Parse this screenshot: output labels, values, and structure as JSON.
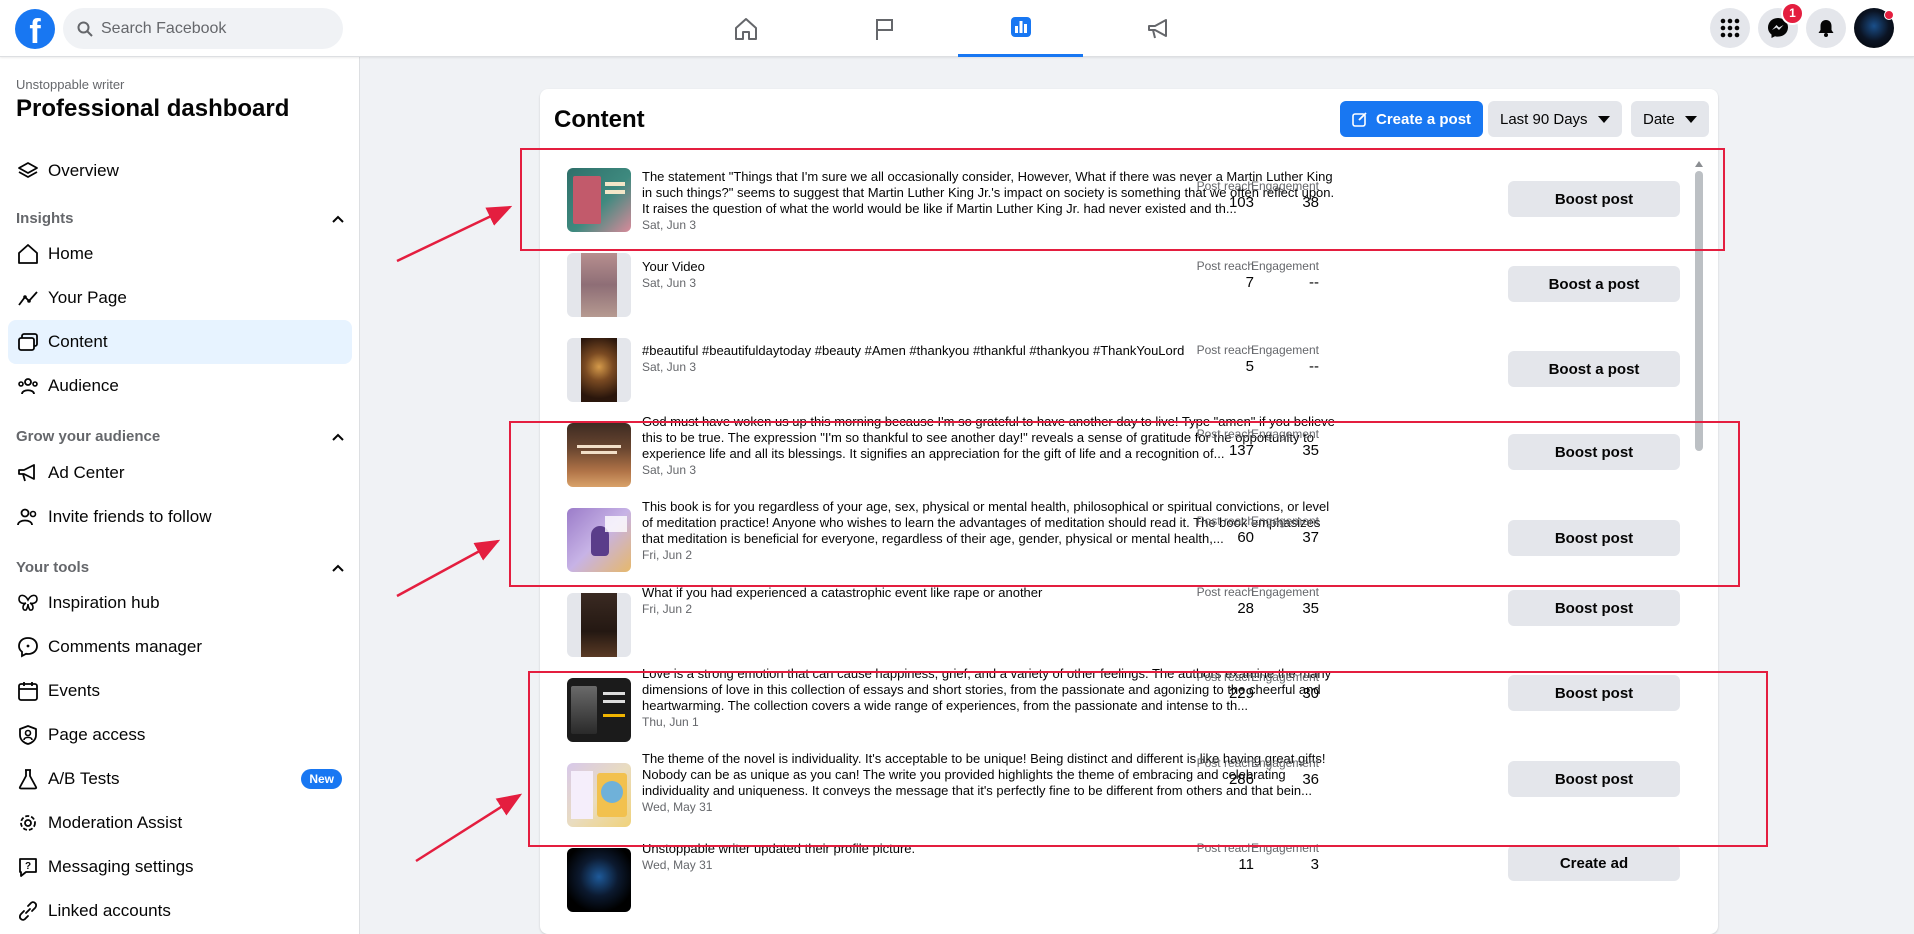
{
  "topbar": {
    "search_placeholder": "Search Facebook",
    "notification_count": "1",
    "nav_tabs": [
      "home-tab",
      "pages-tab",
      "professional-dashboard-tab",
      "ad-center-tab"
    ]
  },
  "sidebar": {
    "page_name": "Unstoppable writer",
    "title": "Professional dashboard",
    "overview": "Overview",
    "sections": {
      "insights": "Insights",
      "grow": "Grow your audience",
      "tools": "Your tools"
    },
    "insights_items": [
      "Home",
      "Your Page",
      "Content",
      "Audience"
    ],
    "grow_items": [
      "Ad Center",
      "Invite friends to follow"
    ],
    "tools_items": [
      "Inspiration hub",
      "Comments manager",
      "Events",
      "Page access",
      "A/B Tests",
      "Moderation Assist",
      "Messaging settings",
      "Linked accounts"
    ],
    "new_badge": "New"
  },
  "content": {
    "title": "Content",
    "create_post": "Create a post",
    "range_filter": "Last 90 Days",
    "sort_filter": "Date",
    "reach_label": "Post reach",
    "engagement_label": "Engagement",
    "posts": [
      {
        "text": "The statement \"Things that I'm sure we all occasionally consider, However, What if there was never a Martin Luther King in such things?\" seems to suggest that Martin Luther King Jr.'s impact on society is something that we often reflect upon. It raises the question of what the world would be like if Martin Luther King Jr. had never existed and th...",
        "date": "Sat, Jun 3",
        "reach": "103",
        "engagement": "38",
        "action": "Boost post"
      },
      {
        "text": "Your Video",
        "date": "Sat, Jun 3",
        "reach": "7",
        "engagement": "--",
        "action": "Boost a post"
      },
      {
        "text": "#beautiful #beautifuldaytoday #beauty #Amen #thankyou #thankful #thankyou #ThankYouLord",
        "date": "Sat, Jun 3",
        "reach": "5",
        "engagement": "--",
        "action": "Boost a post"
      },
      {
        "text": "God must have woken us up this morning because I'm so grateful to have another day to live! Type \"amen\" if you believe this to be true. The expression \"I'm so thankful to see another day!\" reveals a sense of gratitude for the opportunity to experience life and all its blessings. It signifies an appreciation for the gift of life and a recognition of...",
        "date": "Sat, Jun 3",
        "reach": "137",
        "engagement": "35",
        "action": "Boost post"
      },
      {
        "text": "This book is for you regardless of your age, sex, physical or mental health, philosophical or spiritual convictions, or level of meditation practice! Anyone who wishes to learn the advantages of meditation should read it. The book emphasizes that meditation is beneficial for everyone, regardless of their age, gender, physical or mental health,...",
        "date": "Fri, Jun 2",
        "reach": "60",
        "engagement": "37",
        "action": "Boost post"
      },
      {
        "text": "What if you had experienced a catastrophic event like rape or another",
        "date": "Fri, Jun 2",
        "reach": "28",
        "engagement": "35",
        "action": "Boost post"
      },
      {
        "text": "Love is a strong emotion that can cause happiness, grief, and a variety of other feelings. The authors examine the many dimensions of love in this collection of essays and short stories, from the passionate and agonizing to the cheerful and heartwarming. The collection covers a wide range of experiences, from the passionate and intense to th...",
        "date": "Thu, Jun 1",
        "reach": "229",
        "engagement": "30",
        "action": "Boost post"
      },
      {
        "text": "The theme of the novel is individuality. It's acceptable to be unique! Being distinct and different is like having great gifts! Nobody can be as unique as you can! The write you provided highlights the theme of embracing and celebrating individuality and uniqueness. It conveys the message that it's perfectly fine to be different from others and that bein...",
        "date": "Wed, May 31",
        "reach": "286",
        "engagement": "36",
        "action": "Boost post"
      },
      {
        "text": "Unstoppable writer updated their profile picture.",
        "date": "Wed, May 31",
        "reach": "11",
        "engagement": "3",
        "action": "Create ad"
      }
    ]
  },
  "colors": {
    "brand": "#1877f2",
    "annotation": "#e41e3f",
    "active_bg": "#e7f3ff"
  }
}
